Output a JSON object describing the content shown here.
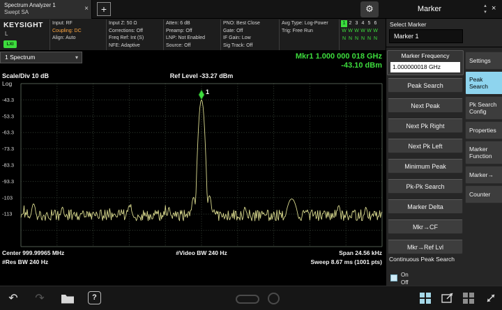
{
  "icons": {
    "close": "×",
    "plus": "+",
    "gear": "⚙",
    "dropdown_arrow": "▾",
    "chevron_up": "▴",
    "chevron_down": "▾",
    "undo": "↶",
    "redo": "↷",
    "help": "?"
  },
  "colors": {
    "accent_green": "#3ddc3d",
    "amber": "#ffa640",
    "highlight_blue": "#8ed4ee",
    "trace_yellow": "#d9d98e"
  },
  "topbar": {
    "tab_line1": "Spectrum Analyzer 1",
    "tab_line2": "Swept SA",
    "menu_title": "Marker"
  },
  "header": {
    "brand": "KEYSIGHT",
    "mode_letter": "L",
    "lxi_badge": "LXI",
    "columns": [
      {
        "lines": [
          {
            "text": "Input: RF"
          },
          {
            "text": "Coupling: DC",
            "amber": true
          },
          {
            "text": "Align: Auto"
          }
        ]
      },
      {
        "lines": [
          {
            "text": "Input Z: 50 Ω"
          },
          {
            "text": "Corrections: Off"
          },
          {
            "text": "Freq Ref: Int (S)"
          },
          {
            "text": "NFE: Adaptive"
          }
        ]
      },
      {
        "lines": [
          {
            "text": "Atten: 6 dB"
          },
          {
            "text": "Preamp: Off"
          },
          {
            "text": "LNP: Not Enabled"
          },
          {
            "text": "Source: Off"
          }
        ]
      },
      {
        "lines": [
          {
            "text": "PNO: Best Close"
          },
          {
            "text": "Gate: Off"
          },
          {
            "text": "IF Gain: Low"
          },
          {
            "text": "Sig Track: Off"
          }
        ]
      },
      {
        "lines": [
          {
            "text": "Avg Type: Log-Power"
          },
          {
            "text": "Trig: Free Run"
          }
        ]
      }
    ],
    "trace_states": {
      "numbers": [
        "1",
        "2",
        "3",
        "4",
        "5",
        "6"
      ],
      "row2": [
        "W",
        "W",
        "W",
        "W",
        "W",
        "W"
      ],
      "row3": [
        "N",
        "N",
        "N",
        "N",
        "N",
        "N"
      ],
      "active_index": 0
    }
  },
  "marker_panel": {
    "select_label": "Select Marker",
    "selected_marker": "Marker 1",
    "freq_label": "Marker Frequency",
    "freq_value": "1.000000018 GHz",
    "buttons": [
      "Peak Search",
      "Next Peak",
      "Next Pk Right",
      "Next Pk Left",
      "Minimum Peak",
      "Pk-Pk Search",
      "Marker Delta",
      "Mkr→CF",
      "Mkr→Ref Lvl"
    ],
    "continuous": {
      "label": "Continuous Peak Search",
      "on": "On",
      "off": "Off",
      "selected": "Off"
    }
  },
  "menu_tabs": [
    {
      "label": "Settings",
      "active": false
    },
    {
      "label": "Peak Search",
      "active": true
    },
    {
      "label": "Pk Search Config",
      "active": false
    },
    {
      "label": "Properties",
      "active": false
    },
    {
      "label": "Marker Function",
      "active": false
    },
    {
      "label": "Marker→",
      "active": false
    },
    {
      "label": "Counter",
      "active": false
    }
  ],
  "display": {
    "trace_selector": "1 Spectrum",
    "marker_readout_line1": "Mkr1 1.000 000 018 GHz",
    "marker_readout_line2": "-43.10 dBm",
    "scale_label": "Scale/Div 10 dB",
    "ref_label": "Ref Level -33.27 dBm",
    "amplitude_scale": "Log",
    "y_ticks": [
      "-43.3",
      "-53.3",
      "-63.3",
      "-73.3",
      "-83.3",
      "-93.3",
      "-103",
      "-113"
    ],
    "center": "Center 999.99965 MHz",
    "video_bw": "#Video BW 240 Hz",
    "span": "Span 24.56 kHz",
    "res_bw": "#Res BW 240 Hz",
    "sweep": "Sweep 8.67 ms (1001 pts)"
  },
  "chart_data": {
    "type": "line",
    "title": "Swept SA spectrum trace",
    "ref_level_dbm": -33.27,
    "scale_db_per_div": 10,
    "divisions": 10,
    "center_freq": "999.99965 MHz",
    "span": "24.56 kHz",
    "res_bw": "240 Hz",
    "video_bw": "240 Hz",
    "sweep": "8.67 ms (1001 pts)",
    "marker": {
      "label": "1",
      "name": "Mkr1",
      "freq": "1.000000018 GHz",
      "level_dbm": -43.1,
      "pos": 0.5
    },
    "noise_floor_dbm": -114,
    "peaks": [
      {
        "pos": 0.5,
        "level_dbm": -43.1,
        "sigma": 0.0045
      },
      {
        "pos": 0.478,
        "level_dbm": -103,
        "sigma": 0.005
      },
      {
        "pos": 0.522,
        "level_dbm": -102,
        "sigma": 0.005
      },
      {
        "pos": 0.75,
        "level_dbm": -104,
        "sigma": 0.012
      },
      {
        "pos": 0.035,
        "level_dbm": -107,
        "sigma": 0.006
      },
      {
        "pos": 0.115,
        "level_dbm": -109,
        "sigma": 0.005
      },
      {
        "pos": 0.3,
        "level_dbm": -108,
        "sigma": 0.005
      },
      {
        "pos": 0.41,
        "level_dbm": -109,
        "sigma": 0.004
      },
      {
        "pos": 0.62,
        "level_dbm": -109,
        "sigma": 0.004
      },
      {
        "pos": 0.88,
        "level_dbm": -108,
        "sigma": 0.005
      },
      {
        "pos": 0.955,
        "level_dbm": -109,
        "sigma": 0.004
      }
    ],
    "seed": 12
  }
}
